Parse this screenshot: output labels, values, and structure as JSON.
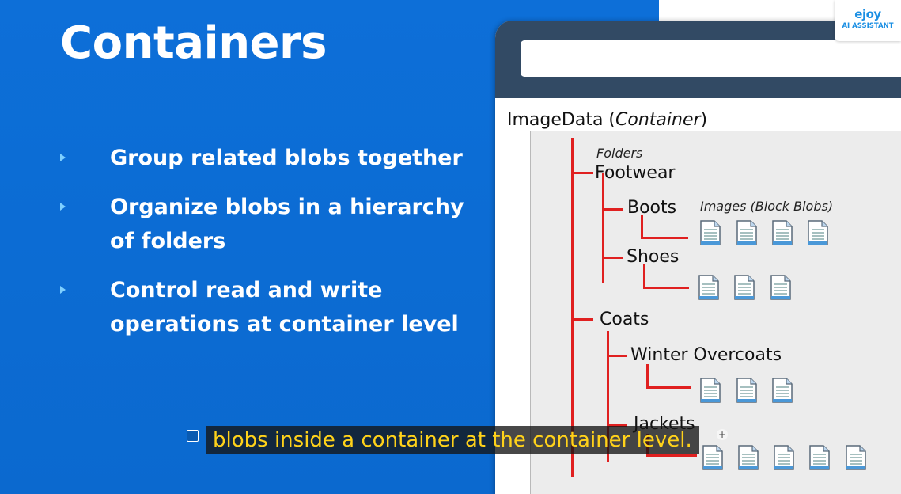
{
  "slide": {
    "title": "Containers",
    "bullets": [
      "Group related blobs together",
      "Organize blobs in a hierarchy of folders",
      "Control read and write operations at container level"
    ]
  },
  "diagram": {
    "container_name": "ImageData",
    "container_tag": "Container",
    "folders_caption": "Folders",
    "images_caption": "Images (Block Blobs)",
    "nodes": [
      "Footwear",
      "Boots",
      "Shoes",
      "Coats",
      "Winter Overcoats",
      "Jackets"
    ],
    "accent_color": "#e02020"
  },
  "overlay": {
    "brand": "ejoy",
    "brand_sub": "AI ASSISTANT",
    "caption": "blobs inside a container at the container level.",
    "caption_color": "#ffd21a"
  }
}
